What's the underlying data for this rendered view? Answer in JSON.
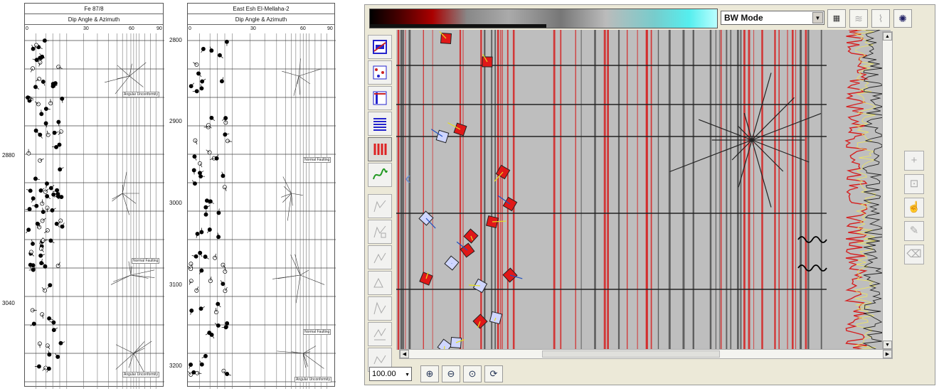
{
  "log_tracks": [
    {
      "title": "Fe 87/8",
      "subtitle": "Dip Angle & Azimuth",
      "scale_ticks": [
        "0",
        "30",
        "60",
        "90"
      ],
      "depths": [
        "2880",
        "3040"
      ],
      "annotations": [
        "Angular Unconformity",
        "Normal Faulting",
        "Angular Unconformity"
      ]
    },
    {
      "title": "East Esh El-Mellaha-2",
      "subtitle": "Dip Angle & Azimuth",
      "scale_ticks": [
        "0",
        "30",
        "60",
        "90"
      ],
      "depths": [
        "2800",
        "2900",
        "3000",
        "3100",
        "3200"
      ],
      "annotations": [
        "Normal Faulting",
        "Normal Faulting",
        "Angular Unconformity"
      ]
    }
  ],
  "viewer": {
    "mode_select": "BW Mode",
    "zoom_value": "100.00",
    "top_icons": [
      "color-palette-icon",
      "curve-display-icon",
      "curve-select-icon",
      "rose-diagram-icon"
    ],
    "left_tools": [
      "image-view-icon",
      "grid-dots-icon",
      "depth-track-icon",
      "lines-icon",
      "red-bars-icon",
      "green-curve-icon",
      "tool-7-icon",
      "tool-8-icon",
      "tool-9-icon",
      "tool-10-icon",
      "tool-11-icon",
      "tool-12-icon",
      "tool-13-icon"
    ],
    "right_tools": [
      "plus-icon",
      "select-icon",
      "pick-icon",
      "pencil-icon",
      "erase-icon"
    ],
    "zoom_buttons": [
      "zoom-in-icon",
      "zoom-out-icon",
      "zoom-fit-icon",
      "zoom-reset-icon"
    ],
    "colors": {
      "accent_red": "#e02020",
      "background_gray": "#bebebe",
      "panel": "#ece9d8"
    }
  }
}
